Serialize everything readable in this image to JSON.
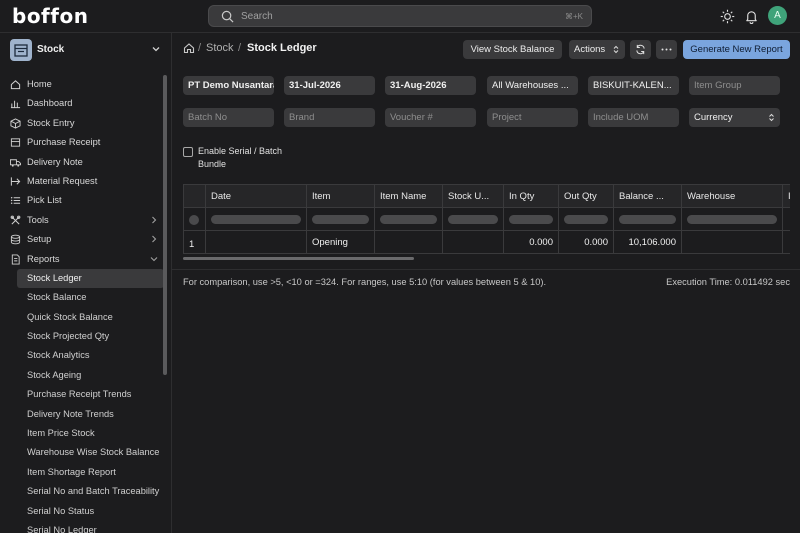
{
  "app": {
    "logo_text": "boffon",
    "avatar_initial": "A"
  },
  "search": {
    "placeholder": "Search",
    "shortcut": "⌘+K"
  },
  "sidebar": {
    "module_label": "Stock",
    "items": [
      {
        "label": "Home",
        "icon": "home-icon"
      },
      {
        "label": "Dashboard",
        "icon": "dashboard-icon"
      },
      {
        "label": "Stock Entry",
        "icon": "stock-entry-icon"
      },
      {
        "label": "Purchase Receipt",
        "icon": "receipt-icon"
      },
      {
        "label": "Delivery Note",
        "icon": "truck-icon"
      },
      {
        "label": "Material Request",
        "icon": "material-request-icon"
      },
      {
        "label": "Pick List",
        "icon": "list-icon"
      },
      {
        "label": "Tools",
        "icon": "tools-icon"
      },
      {
        "label": "Setup",
        "icon": "setup-icon"
      },
      {
        "label": "Reports",
        "icon": "reports-icon"
      }
    ],
    "report_items": [
      "Stock Ledger",
      "Stock Balance",
      "Quick Stock Balance",
      "Stock Projected Qty",
      "Stock Analytics",
      "Stock Ageing",
      "Purchase Receipt Trends",
      "Delivery Note Trends",
      "Item Price Stock",
      "Warehouse Wise Stock Balance",
      "Item Shortage Report",
      "Serial No and Batch Traceability",
      "Serial No Status",
      "Serial No Ledger"
    ]
  },
  "breadcrumb": {
    "parent": "Stock",
    "current": "Stock Ledger",
    "separator": "/"
  },
  "toolbar": {
    "view_stock_balance": "View Stock Balance",
    "actions": "Actions",
    "generate_report": "Generate New Report"
  },
  "filters": {
    "company": "PT Demo Nusantara",
    "from_date": "31-Jul-2026",
    "to_date": "31-Aug-2026",
    "warehouse": "All Warehouses ...",
    "item": "BISKUIT-KALEN...",
    "item_group_placeholder": "Item Group",
    "batch_no_placeholder": "Batch No",
    "brand_placeholder": "Brand",
    "voucher_placeholder": "Voucher #",
    "project_placeholder": "Project",
    "include_uom_placeholder": "Include UOM",
    "currency": "Currency",
    "serial_batch_label": "Enable Serial / Batch Bundle"
  },
  "table": {
    "columns": [
      "Date",
      "Item",
      "Item Name",
      "Stock U...",
      "In Qty",
      "Out Qty",
      "Balance ...",
      "Warehouse",
      "I"
    ],
    "rows": [
      {
        "index": "1",
        "date": "",
        "item": "Opening",
        "item_name": "",
        "stock_uom": "",
        "in_qty": "0.000",
        "out_qty": "0.000",
        "balance": "10,106.000",
        "warehouse": ""
      }
    ]
  },
  "footer": {
    "hint": "For comparison, use >5, <10 or =324. For ranges, use 5:10 (for values between 5 & 10).",
    "execution_time": "Execution Time: 0.011492 sec"
  },
  "colors": {
    "accent": "#7aa5de",
    "background": "#1c1c1e",
    "surface": "#3a3a3c",
    "avatar": "#3fa37a"
  }
}
